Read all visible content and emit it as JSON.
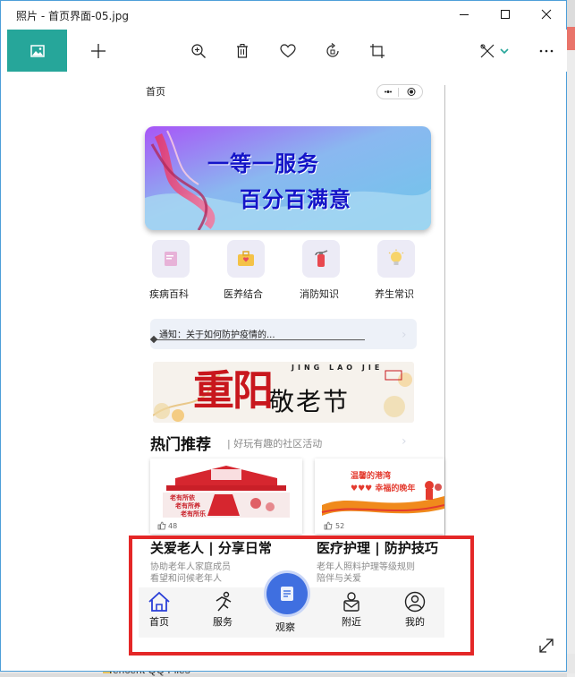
{
  "window": {
    "title": "照片 - 首页界面-05.jpg"
  },
  "background": {
    "taskbar_text": "Tencent QQ Files"
  },
  "toolbar": {
    "items": [
      "photo-tab",
      "add",
      "zoom-in",
      "delete",
      "favorite",
      "rotate",
      "crop",
      "edit",
      "more"
    ]
  },
  "phone": {
    "page_title": "首页",
    "banner": {
      "line1": "一等一服务",
      "line2": "百分百满意"
    },
    "categories": [
      {
        "label": "疾病百科",
        "icon": "book-icon"
      },
      {
        "label": "医养结合",
        "icon": "medkit-icon"
      },
      {
        "label": "消防知识",
        "icon": "extinguisher-icon"
      },
      {
        "label": "养生常识",
        "icon": "bulb-icon"
      }
    ],
    "notice": "通知：关于如何防护疫情的...",
    "festival": {
      "big": "重阳",
      "small": "敬老节",
      "pinyin": "JING LAO JIE"
    },
    "hot": {
      "title": "热门推荐",
      "subtitle": "| 好玩有趣的社区活动"
    },
    "cards": [
      {
        "likes": "48",
        "banner_text": "老有所依 老有所养 老有所乐",
        "title": "关爱老人 | 分享日常",
        "desc1": "协助老年人家庭成员",
        "desc2": "看望和问候老年人"
      },
      {
        "likes": "52",
        "banner_line1": "温馨的港湾",
        "banner_line2": "幸福的晚年",
        "title": "医疗护理 | 防护技巧",
        "desc1": "老年人照料护理等级规则",
        "desc2": "陪伴与关爱"
      }
    ],
    "tabs": [
      {
        "label": "首页",
        "icon": "home-icon"
      },
      {
        "label": "服务",
        "icon": "runner-icon"
      },
      {
        "label": "观察",
        "icon": "document-icon"
      },
      {
        "label": "附近",
        "icon": "mail-user-icon"
      },
      {
        "label": "我的",
        "icon": "user-icon"
      }
    ]
  },
  "colors": {
    "accent": "#26a69a",
    "highlight_box": "#e42727",
    "tab_primary": "#3f6fe0"
  }
}
